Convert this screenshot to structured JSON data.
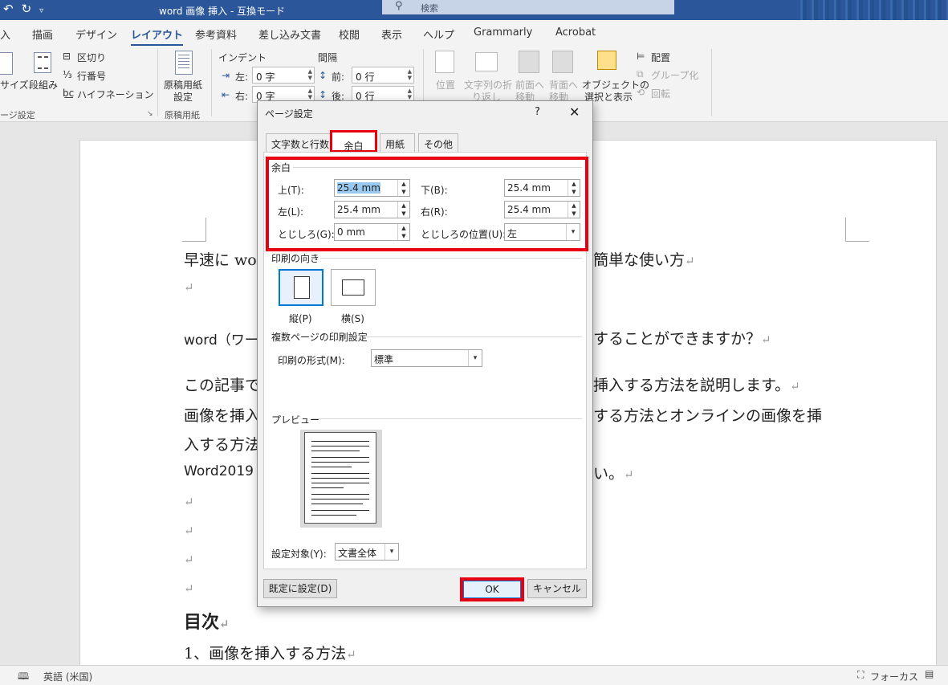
{
  "titlebar": {
    "qat_icons": [
      "undo-icon",
      "redo-icon",
      "customize-qat-icon"
    ],
    "title": "word 画像 挿入  -  互換モード",
    "search_placeholder": "検索"
  },
  "tabs": [
    "入",
    "描画",
    "デザイン",
    "レイアウト",
    "参考資料",
    "差し込み文書",
    "校閲",
    "表示",
    "ヘルプ",
    "Grammarly",
    "Acrobat"
  ],
  "active_tab": "レイアウト",
  "ribbon": {
    "size_label": "サイズ",
    "columns_label": "段組み",
    "breaks_label": "区切り",
    "line_numbers_label": "行番号",
    "hyphenation_label": "ハイフネーション",
    "page_setup_group": "ージ設定",
    "manuscript_btn_line1": "原稿用紙",
    "manuscript_btn_line2": "設定",
    "manuscript_group": "原稿用紙",
    "indent_label": "インデント",
    "spacing_label": "間隔",
    "indent_left_label": "左:",
    "indent_left_value": "0 字",
    "indent_right_label": "右:",
    "indent_right_value": "0 字",
    "spacing_before_label": "前:",
    "spacing_before_value": "0 行",
    "spacing_after_label": "後:",
    "spacing_after_value": "0 行",
    "position_label": "位置",
    "wrap_line1": "文字列の折",
    "wrap_line2": "り返し",
    "forward_line1": "前面へ",
    "forward_line2": "移動",
    "backward_line1": "背面へ",
    "backward_line2": "移動",
    "selection_line1": "オブジェクトの",
    "selection_line2": "選択と表示",
    "align_label": "配置",
    "group_label": "グループ化",
    "rotate_label": "回転"
  },
  "document": {
    "line1_left": "早速に wo",
    "line1_right": "簡単な使い方",
    "line2_left": "word（ワー",
    "line2_right": "することができますか？",
    "line3_left": "この記事で",
    "line3_right": "挿入する方法を説明します。",
    "line4_left": "画像を挿入",
    "line4_right": "する方法とオンラインの画像を挿",
    "line5_left": "入する方法",
    "line6_left": "Word2019",
    "line6_right": "い。",
    "heading": "目次",
    "toc1": "1、画像を挿入する方法"
  },
  "statusbar": {
    "language": "英語 (米国)",
    "focus": "フォーカス"
  },
  "dialog": {
    "title": "ページ設定",
    "help": "?",
    "close": "✕",
    "tabs": [
      "文字数と行数",
      "余白",
      "用紙",
      "その他"
    ],
    "selected_tab": "余白",
    "margins_section": "余白",
    "top_label": "上(T):",
    "top_value": "25.4 mm",
    "bottom_label": "下(B):",
    "bottom_value": "25.4 mm",
    "left_label": "左(L):",
    "left_value": "25.4 mm",
    "right_label": "右(R):",
    "right_value": "25.4 mm",
    "gutter_label": "とじしろ(G):",
    "gutter_value": "0 mm",
    "gutter_pos_label": "とじしろの位置(U):",
    "gutter_pos_value": "左",
    "orientation_section": "印刷の向き",
    "portrait_label": "縦(P)",
    "landscape_label": "横(S)",
    "multipage_section": "複数ページの印刷設定",
    "print_format_label": "印刷の形式(M):",
    "print_format_value": "標準",
    "preview_section": "プレビュー",
    "apply_to_label": "設定対象(Y):",
    "apply_to_value": "文書全体",
    "default_button": "既定に設定(D)",
    "ok_button": "OK",
    "cancel_button": "キャンセル",
    "highlight_color": "#e60012"
  }
}
